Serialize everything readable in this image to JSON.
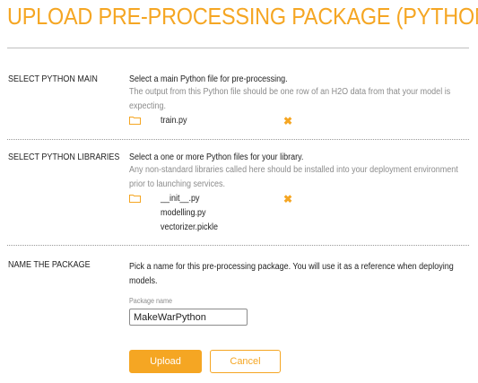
{
  "page": {
    "title": "UPLOAD PRE-PROCESSING PACKAGE (PYTHON)"
  },
  "main_section": {
    "label": "SELECT PYTHON MAIN",
    "description": "Select a main Python file for pre-processing.",
    "help": "The output from this Python file should be one row of an H2O data from that your model is expecting.",
    "file": "train.py"
  },
  "libraries_section": {
    "label": "SELECT PYTHON LIBRARIES",
    "description": "Select a one or more Python files for your library.",
    "help": "Any non-standard libraries called here should be installed into your deployment environment prior to launching services.",
    "files": [
      "__init__.py",
      "modelling.py",
      "vectorizer.pickle"
    ]
  },
  "name_section": {
    "label": "NAME THE PACKAGE",
    "description": "Pick a name for this pre-processing package. You will use it as a reference when deploying models.",
    "input_label": "Package name",
    "input_value": "MakeWarPython"
  },
  "actions": {
    "upload_label": "Upload",
    "cancel_label": "Cancel"
  },
  "icons": {
    "folder": "folder-icon",
    "remove": "remove-icon"
  },
  "colors": {
    "accent": "#f5a623",
    "muted_text": "#8c8c8c"
  }
}
